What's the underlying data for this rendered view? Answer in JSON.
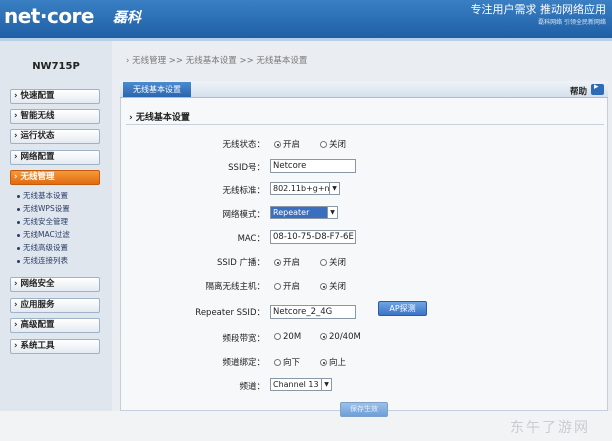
{
  "header": {
    "logo": "net·core",
    "logo_cn": "磊科",
    "slogan": "专注用户需求  推动网络应用",
    "sub_slogan": "磊科网络 引领全民新网络"
  },
  "sidebar": {
    "model": "NW715P",
    "items": [
      {
        "label": "› 快速配置"
      },
      {
        "label": "› 智能无线"
      },
      {
        "label": "› 运行状态"
      },
      {
        "label": "› 网络配置"
      },
      {
        "label": "› 无线管理",
        "active": true
      },
      {
        "label": "› 网络安全"
      },
      {
        "label": "› 应用服务"
      },
      {
        "label": "› 高级配置"
      },
      {
        "label": "› 系统工具"
      }
    ],
    "subitems": [
      "无线基本设置",
      "无线WPS设置",
      "无线安全管理",
      "无线MAC过滤",
      "无线高级设置",
      "无线连接列表"
    ]
  },
  "breadcrumb": "› 无线管理  >> 无线基本设置  >> 无线基本设置",
  "tab_label": "无线基本设置",
  "help_label": "帮助",
  "section_title": "› 无线基本设置",
  "form": {
    "wireless_status": {
      "label": "无线状态：",
      "opt1": "开启",
      "opt2": "关闭",
      "selected": "开启"
    },
    "ssid": {
      "label": "SSID号：",
      "value": "Netcore"
    },
    "standard": {
      "label": "无线标准：",
      "value": "802.11b+g+n"
    },
    "net_mode": {
      "label": "网络模式：",
      "value": "Repeater"
    },
    "mac": {
      "label": "MAC：",
      "value": "08-10-75-D8-F7-6E"
    },
    "ssid_broadcast": {
      "label": "SSID 广播：",
      "opt1": "开启",
      "opt2": "关闭",
      "selected": "开启"
    },
    "isolate": {
      "label": "隔离无线主机：",
      "opt1": "开启",
      "opt2": "关闭",
      "selected": "关闭"
    },
    "repeater_ssid": {
      "label": "Repeater SSID：",
      "value": "Netcore_2_4G",
      "button": "AP探测"
    },
    "bandwidth": {
      "label": "频段带宽：",
      "opt1": "20M",
      "opt2": "20/40M",
      "selected": "20/40M"
    },
    "channel_bind": {
      "label": "频道绑定：",
      "opt1": "向下",
      "opt2": "向上",
      "selected": "向上"
    },
    "channel": {
      "label": "频道：",
      "value": "Channel 13"
    }
  },
  "save_label": "保存生效",
  "watermark": "东午了游网"
}
